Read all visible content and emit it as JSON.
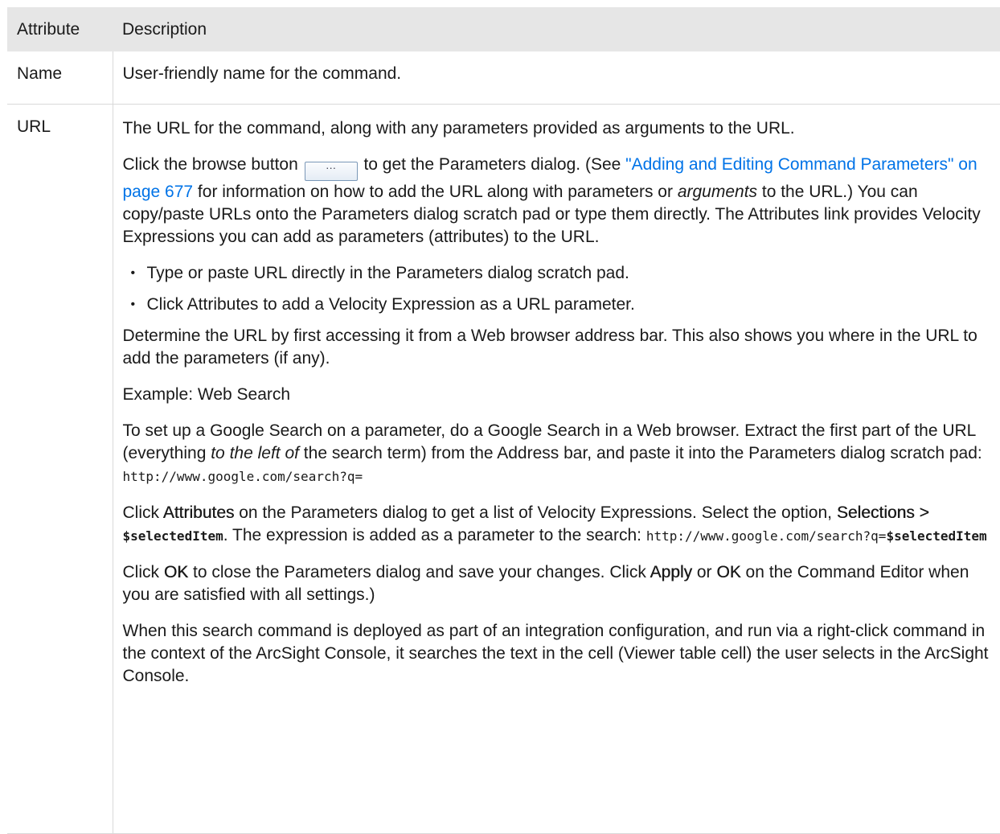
{
  "table": {
    "header": {
      "attribute": "Attribute",
      "description": "Description"
    },
    "rows": [
      {
        "attribute": "Name",
        "description": "User-friendly name for the command."
      },
      {
        "attribute": "URL"
      }
    ]
  },
  "url_description": {
    "p1": "The URL for the command, along with any parameters provided as arguments to the URL.",
    "p2": {
      "before_button": "Click the browse button",
      "browse_button_label": "···",
      "after_button": " to get the Parameters dialog. (See ",
      "link": "\"Adding and Editing Command Parameters\" on page 677",
      "after_link": " for information on how to add the URL along with parameters or ",
      "arguments_italic": "arguments",
      "after_arguments": " to the URL.) You can copy/paste URLs onto the Parameters dialog scratch pad or type them directly. The Attributes link provides Velocity Expressions you can add as parameters (attributes) to the URL."
    },
    "bullets": [
      "Type or paste URL directly in the Parameters dialog scratch pad.",
      "Click Attributes to add a Velocity Expression as a URL parameter."
    ],
    "p3": "Determine the URL by first accessing it from a Web browser address bar. This also shows you where in the URL to add the parameters (if any).",
    "example_heading": "Example: Web Search",
    "p4": {
      "text1": "To set up a Google Search on a parameter, do a Google Search in a Web browser. Extract the first part of the URL (everything ",
      "italic": "to the left of",
      "text2": " the search term) from the Address bar, and paste it into the Parameters dialog scratch pad: ",
      "code": "http://www.google.com/search?q="
    },
    "p5": {
      "text1": "Click ",
      "attributes_bold": "Attributes",
      "text2": " on the Parameters dialog to get a list of Velocity Expressions. Select the option, ",
      "selections_bold": "Selections > ",
      "selected_item_code": "$selectedItem",
      "text3": ". The expression is added as a parameter to the search: ",
      "code_url": "http://www.google.com/search?q=",
      "code_var": "$selectedItem"
    },
    "p6": {
      "text1": "Click ",
      "ok_bold": "OK",
      "text2": " to close the Parameters dialog and save your changes. Click ",
      "apply_bold": "Apply",
      "text3": " or ",
      "ok2_bold": "OK",
      "text4": " on the Command Editor when you are satisfied with all settings.)"
    },
    "p7": "When this search command is deployed as part of an integration configuration, and run via a right-click command in the context of the ArcSight Console, it searches the text in the cell (Viewer table cell) the user selects in the ArcSight Console."
  }
}
